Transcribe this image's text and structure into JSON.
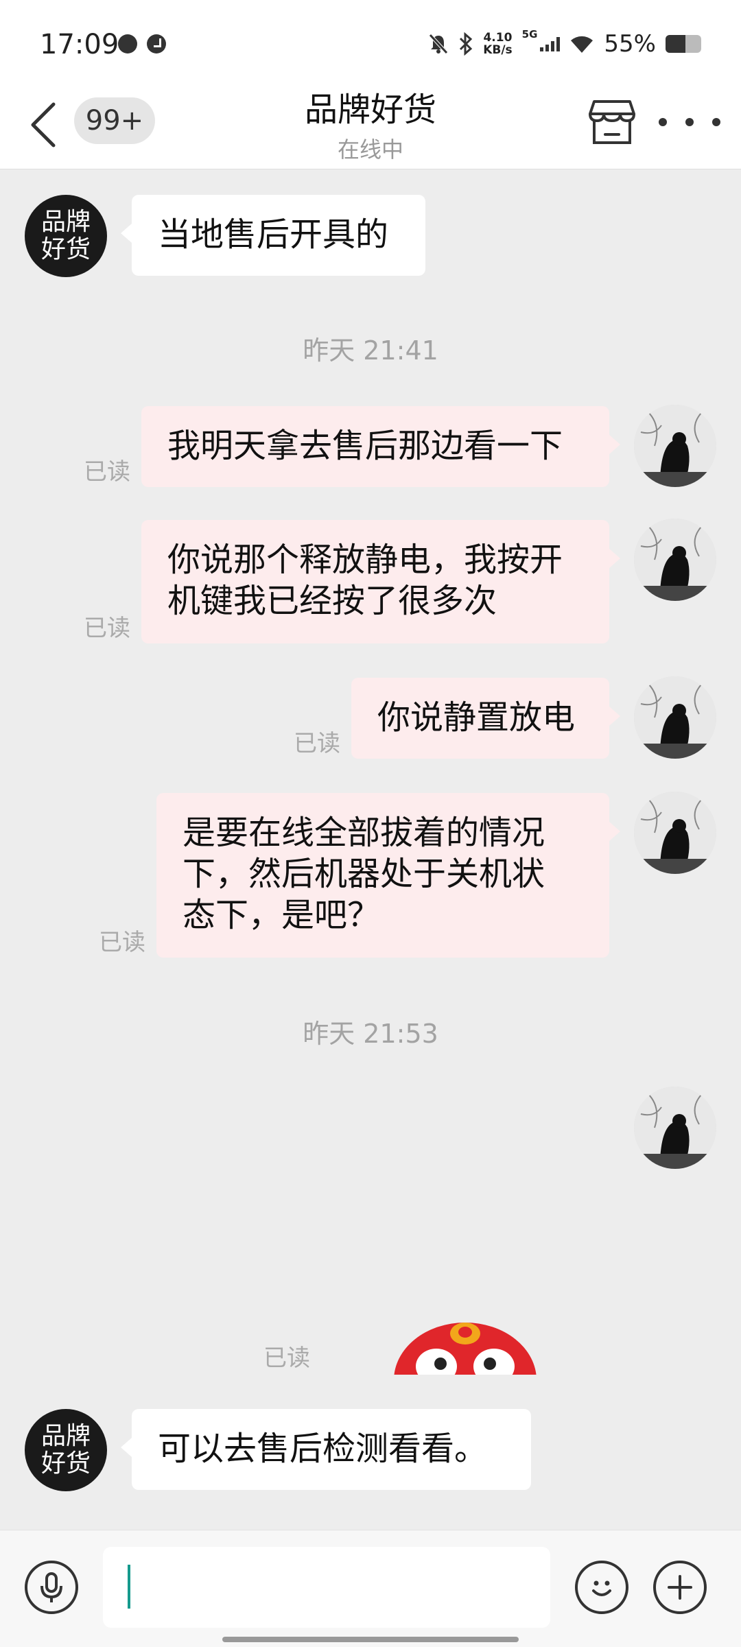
{
  "status_bar": {
    "time": "17:09",
    "speed_value": "4.10",
    "speed_unit": "KB/s",
    "network": "5G",
    "battery_percent": "55%",
    "battery_level": 0.55,
    "icons": [
      "location-icon",
      "timer-icon",
      "mute-icon",
      "bluetooth-icon",
      "signal-icon",
      "wifi-icon",
      "battery-icon"
    ]
  },
  "header": {
    "back_icon": "chevron-left-icon",
    "unread_count": "99+",
    "title": "品牌好货",
    "subtitle": "在线中",
    "shop_icon": "store-icon",
    "more_icon": "more-horizontal-icon"
  },
  "shop_avatar": {
    "line1": "品牌",
    "line2": "好货"
  },
  "messages": [
    {
      "from": "shop",
      "text": "当地售后开具的"
    },
    {
      "type": "time",
      "text": "昨天 21:41"
    },
    {
      "from": "me",
      "text": "我明天拿去售后那边看一下",
      "read": "已读"
    },
    {
      "from": "me",
      "lines": [
        "你说那个释放静电，我按开",
        "机键我已经按了很多次"
      ],
      "read": "已读"
    },
    {
      "from": "me",
      "text": "你说静置放电",
      "read": "已读"
    },
    {
      "from": "me",
      "lines": [
        "是要在线全部拔着的情况",
        "下，然后机器处于关机状",
        "态下，是吧？"
      ],
      "read": "已读"
    },
    {
      "type": "time",
      "text": "昨天 21:53"
    },
    {
      "from": "me",
      "kind": "sticker",
      "read": "已读"
    },
    {
      "from": "shop",
      "text": "可以去售后检测看看。"
    }
  ],
  "input_bar": {
    "voice_icon": "microphone-icon",
    "text_value": "",
    "emoji_icon": "smiley-icon",
    "plus_icon": "plus-icon"
  },
  "colors": {
    "background": "#ededed",
    "out_bubble": "#fdeced",
    "in_bubble": "#ffffff",
    "caret": "#159a8d"
  }
}
